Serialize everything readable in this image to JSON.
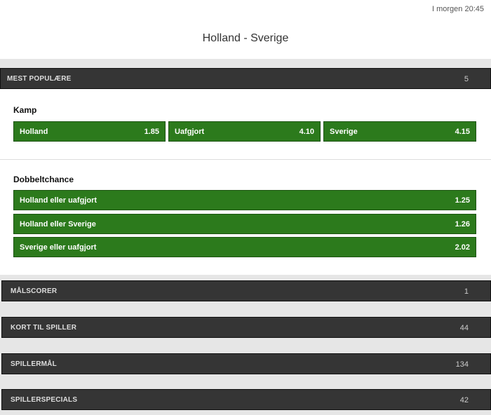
{
  "header": {
    "time": "I morgen 20:45",
    "match": "Holland - Sverige"
  },
  "popular": {
    "label": "MEST POPULÆRE",
    "count": "5"
  },
  "kamp": {
    "title": "Kamp",
    "options": [
      {
        "label": "Holland",
        "odds": "1.85"
      },
      {
        "label": "Uafgjort",
        "odds": "4.10"
      },
      {
        "label": "Sverige",
        "odds": "4.15"
      }
    ]
  },
  "dobbeltchance": {
    "title": "Dobbeltchance",
    "options": [
      {
        "label": "Holland eller uafgjort",
        "odds": "1.25"
      },
      {
        "label": "Holland eller Sverige",
        "odds": "1.26"
      },
      {
        "label": "Sverige eller uafgjort",
        "odds": "2.02"
      }
    ]
  },
  "sections": [
    {
      "label": "MÅLSCORER",
      "count": "1"
    },
    {
      "label": "KORT TIL SPILLER",
      "count": "44"
    },
    {
      "label": "SPILLERMÅL",
      "count": "134"
    },
    {
      "label": "SPILLERSPECIALS",
      "count": "42"
    }
  ]
}
